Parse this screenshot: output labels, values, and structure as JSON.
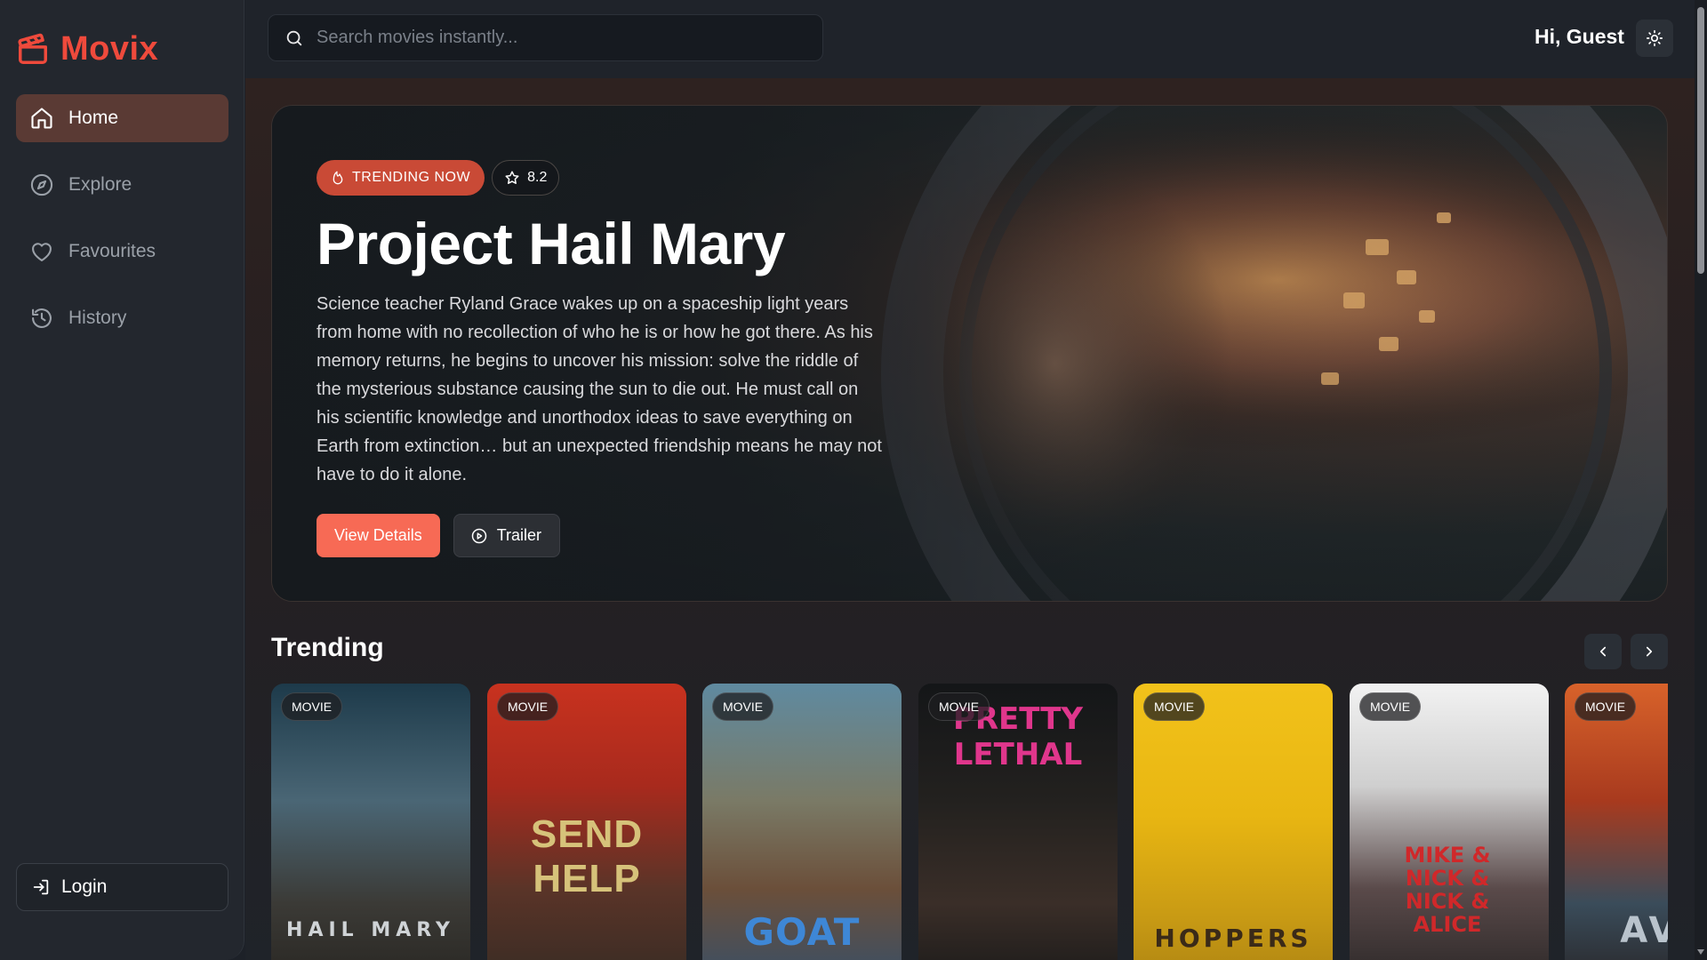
{
  "app": {
    "name": "Movix"
  },
  "sidebar": {
    "items": [
      {
        "label": "Home",
        "icon": "home-icon",
        "active": true
      },
      {
        "label": "Explore",
        "icon": "compass-icon",
        "active": false
      },
      {
        "label": "Favourites",
        "icon": "heart-icon",
        "active": false
      },
      {
        "label": "History",
        "icon": "history-icon",
        "active": false
      }
    ],
    "login_label": "Login"
  },
  "header": {
    "search_placeholder": "Search movies instantly...",
    "greeting": "Hi, Guest"
  },
  "hero": {
    "badge_trending": "TRENDING NOW",
    "rating": "8.2",
    "title": "Project Hail Mary",
    "description": "Science teacher Ryland Grace wakes up on a spaceship light years from home with no recollection of who he is or how he got there. As his memory returns, he begins to uncover his mission: solve the riddle of the mysterious substance causing the sun to die out. He must call on his scientific knowledge and unorthodox ideas to save everything on Earth from extinction… but an unexpected friendship means he may not have to do it alone.",
    "details_label": "View Details",
    "trailer_label": "Trailer"
  },
  "trending": {
    "title": "Trending",
    "cards": [
      {
        "tag": "MOVIE",
        "poster_text": "HAIL MARY"
      },
      {
        "tag": "MOVIE",
        "poster_text": "SEND HELP"
      },
      {
        "tag": "MOVIE",
        "poster_text": "GOAT"
      },
      {
        "tag": "MOVIE",
        "poster_text": "PRETTY LETHAL"
      },
      {
        "tag": "MOVIE",
        "poster_text": "HOPPERS"
      },
      {
        "tag": "MOVIE",
        "poster_text": "MIKE & NICK & NICK & ALICE"
      },
      {
        "tag": "MOVIE",
        "poster_text": "AVA"
      }
    ]
  },
  "colors": {
    "accent": "#ef4a3c",
    "button_primary": "#f76a55",
    "active_nav": "#5a3a34"
  }
}
